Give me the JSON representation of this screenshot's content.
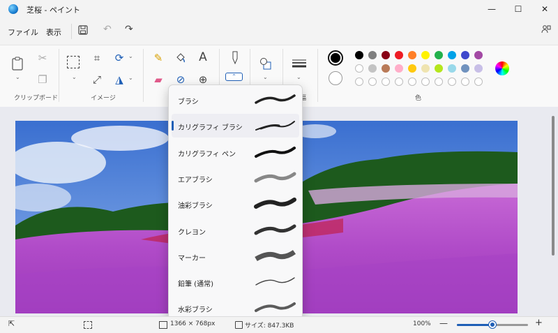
{
  "window": {
    "title": "芝桜 - ペイント",
    "minimize_glyph": "—",
    "maximize_glyph": "☐",
    "close_glyph": "✕"
  },
  "menu": {
    "file": "ファイル",
    "view": "表示"
  },
  "toolbar_icons": {
    "save": "save-icon",
    "undo": "undo-icon",
    "redo": "redo-icon",
    "share": "share-icon"
  },
  "ribbon": {
    "groups": {
      "clipboard": "クリップボード",
      "image": "イメージ",
      "size": "幅",
      "colors": "色"
    }
  },
  "colors": {
    "primary": "#000000",
    "secondary": "#ffffff",
    "row1": [
      "#000000",
      "#7f7f7f",
      "#880015",
      "#ed1c24",
      "#ff7f27",
      "#fff200",
      "#22b14c",
      "#00a2e8",
      "#3f48cc",
      "#a349a4"
    ],
    "row2": [
      "#ffffff",
      "#c3c3c3",
      "#b97a57",
      "#ffaec9",
      "#ffc90e",
      "#efe4b0",
      "#b5e61d",
      "#99d9ea",
      "#7092be",
      "#c8bfe7"
    ]
  },
  "brush_menu": {
    "items": [
      {
        "label": "ブラシ",
        "selected": false
      },
      {
        "label": "カリグラフィ ブラシ",
        "selected": true
      },
      {
        "label": "カリグラフィ ペン",
        "selected": false
      },
      {
        "label": "エアブラシ",
        "selected": false
      },
      {
        "label": "油彩ブラシ",
        "selected": false
      },
      {
        "label": "クレヨン",
        "selected": false
      },
      {
        "label": "マーカー",
        "selected": false
      },
      {
        "label": "鉛筆 (通常)",
        "selected": false
      },
      {
        "label": "水彩ブラシ",
        "selected": false
      }
    ]
  },
  "status": {
    "dimensions": "1366 × 768px",
    "file_size": "サイズ: 847.3KB",
    "zoom": "100%",
    "zoom_level": 0.5
  }
}
